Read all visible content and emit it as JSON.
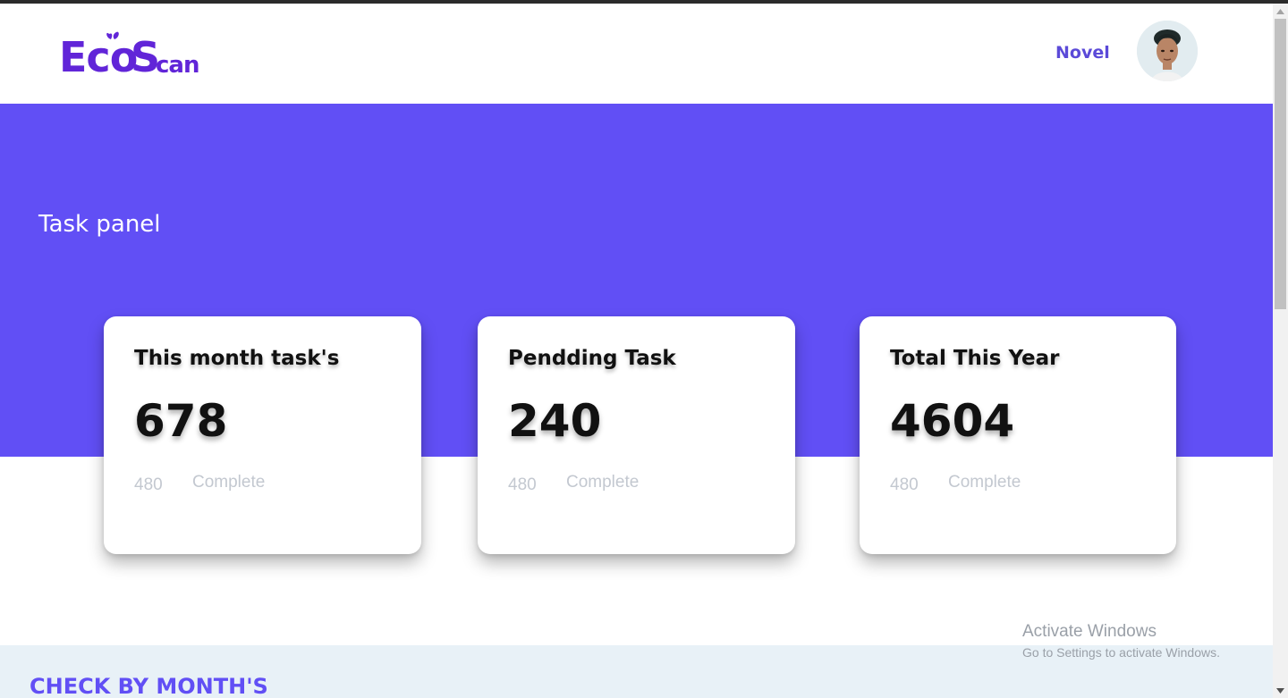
{
  "brand": {
    "logo_part1": "Eco",
    "logo_part2": "S",
    "logo_part3": "can",
    "color": "#6125d8"
  },
  "header": {
    "user_name": "Novel"
  },
  "hero": {
    "title": "Task panel",
    "background": "#614ff5"
  },
  "cards": [
    {
      "title": "This month task's",
      "value": "678",
      "count": "480",
      "status": "Complete"
    },
    {
      "title": "Pendding Task",
      "value": "240",
      "count": "480",
      "status": "Complete"
    },
    {
      "title": "Total This Year",
      "value": "4604",
      "count": "480",
      "status": "Complete"
    }
  ],
  "month_section": {
    "title": "CHECK BY MONTH'S"
  },
  "watermark": {
    "title": "Activate Windows",
    "subtitle": "Go to Settings to activate Windows."
  },
  "icons": {
    "scroll_up": "chevron-up-icon",
    "scroll_down": "chevron-down-icon",
    "logo_leaf": "leaf-icon"
  }
}
